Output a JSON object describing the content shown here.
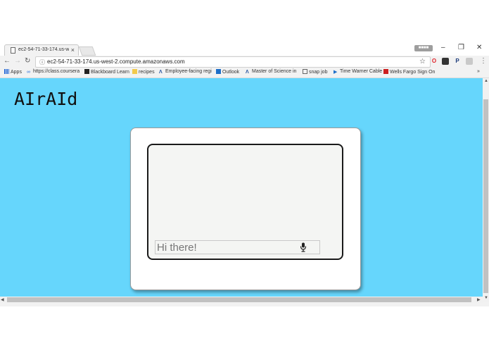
{
  "browser": {
    "tab_title": "ec2-54-71-33-174.us-we",
    "tab_close": "×",
    "profile_label": "■■■■",
    "window_controls": [
      "–",
      "❐",
      "✕"
    ],
    "url": "ec2-54-71-33-174.us-west-2.compute.amazonaws.com",
    "extensions": [
      {
        "icon": "opera-icon",
        "color": "#e0242b",
        "glyph": "O"
      },
      {
        "icon": "ghost-extension-icon",
        "color": "#333333",
        "glyph": "☗"
      },
      {
        "icon": "paypal-icon",
        "color": "#1a3a7a",
        "glyph": "P"
      },
      {
        "icon": "extension-grey-icon",
        "color": "#b5b5b5",
        "glyph": "▢"
      }
    ],
    "menu_glyph": "⋮"
  },
  "bookmarks": [
    {
      "label": "Apps",
      "icon": "apps-grid-icon"
    },
    {
      "label": "https://class.coursera",
      "icon": "coursera-icon"
    },
    {
      "label": "Blackboard Learn",
      "icon": "blackboard-icon"
    },
    {
      "label": "recipes",
      "icon": "folder-icon"
    },
    {
      "label": "Employee-facing regi",
      "icon": "a-logo-icon"
    },
    {
      "label": "Outlook",
      "icon": "outlook-icon"
    },
    {
      "label": "Master of Science in",
      "icon": "a-logo-icon"
    },
    {
      "label": "snap job",
      "icon": "page-icon"
    },
    {
      "label": "Time Warner Cable",
      "icon": "play-icon"
    },
    {
      "label": "Wells Fargo Sign On",
      "icon": "wells-fargo-icon"
    }
  ],
  "bookmarks_overflow": "»",
  "page": {
    "brand": "AIrAId",
    "chat_input_placeholder": "Hi there!",
    "accent_color": "#66d6fc"
  }
}
